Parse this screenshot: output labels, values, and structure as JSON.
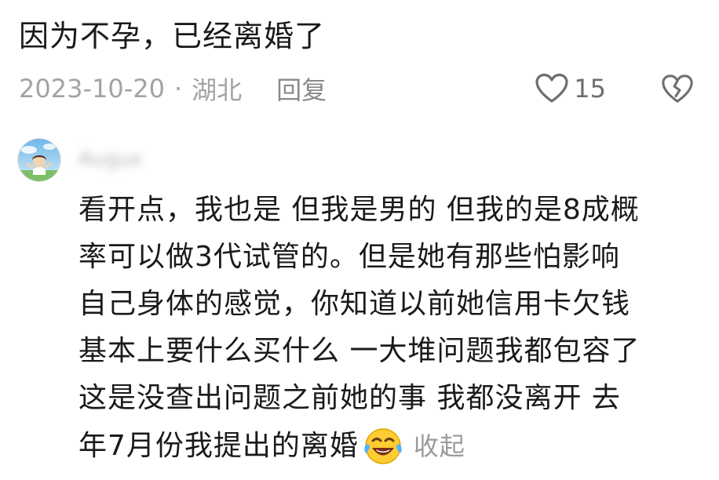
{
  "top_comment": {
    "text": "因为不孕，已经离婚了",
    "date": "2023-10-20",
    "separator": "·",
    "location": "湖北",
    "reply_label": "回复",
    "like_count": "15",
    "icons": {
      "like": "heart-outline-icon",
      "dislike": "broken-heart-icon"
    }
  },
  "reply_comment": {
    "avatar": "user-avatar",
    "username": "Augus",
    "lines": [
      "看开点，我也是 但我是男的 但我的是8成概",
      "率可以做3代试管的。但是她有那些怕影响",
      "自己身体的感觉，你知道以前她信用卡欠钱",
      "基本上要什么买什么 一大堆问题我都包容了",
      "这是没查出问题之前她的事 我都没离开  去",
      "年7月份我提出的离婚"
    ],
    "emoji": "laughing-tears-emoji",
    "collapse_label": "收起"
  },
  "colors": {
    "text_primary": "#1a1a1a",
    "text_secondary": "#a3a3a3",
    "icon_gray": "#6e6e6e",
    "background": "#ffffff"
  }
}
